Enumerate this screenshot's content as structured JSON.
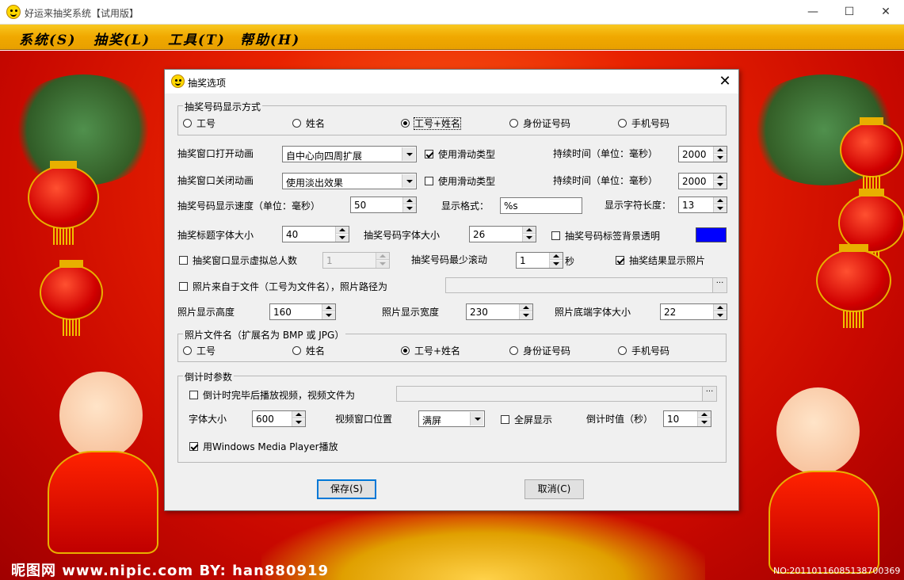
{
  "window": {
    "title": "好运来抽奖系统【试用版】",
    "minimize": "—",
    "maximize": "☐",
    "close": "✕"
  },
  "menu": [
    "系统(S)",
    "抽奖(L)",
    "工具(T)",
    "帮助(H)"
  ],
  "background": {
    "watermark": "昵图网 www.nipic.com  BY: han880919",
    "watermark_no": "NO:20110116085138700369"
  },
  "dialog": {
    "title": "抽奖选项",
    "close": "✕",
    "display_mode_group": {
      "label": "抽奖号码显示方式",
      "options": [
        "工号",
        "姓名",
        "工号+姓名",
        "身份证号码",
        "手机号码"
      ],
      "selected": "工号+姓名"
    },
    "open_anim": {
      "label": "抽奖窗口打开动画",
      "value": "自中心向四周扩展",
      "slide_label": "使用滑动类型",
      "slide_checked": true,
      "duration_label": "持续时间（单位：毫秒）",
      "duration": "2000"
    },
    "close_anim": {
      "label": "抽奖窗口关闭动画",
      "value": "使用淡出效果",
      "slide_label": "使用滑动类型",
      "slide_checked": false,
      "duration_label": "持续时间（单位：毫秒）",
      "duration": "2000"
    },
    "speed": {
      "label": "抽奖号码显示速度（单位：毫秒）",
      "value": "50",
      "format_label": "显示格式：",
      "format_value": "%s",
      "length_label": "显示字符长度：",
      "length_value": "13"
    },
    "fonts": {
      "title_label": "抽奖标题字体大小",
      "title_value": "40",
      "number_label": "抽奖号码字体大小",
      "number_value": "26",
      "transparent_label": "抽奖号码标签背景透明",
      "transparent_checked": false,
      "color": "#0000ff"
    },
    "virtual": {
      "label": "抽奖窗口显示虚拟总人数",
      "checked": false,
      "value": "1",
      "min_roll_label": "抽奖号码最少滚动",
      "min_roll_value": "1",
      "unit": "秒",
      "show_photo_label": "抽奖结果显示照片",
      "show_photo_checked": true
    },
    "photo_path": {
      "label": "照片来自于文件（工号为文件名），照片路径为",
      "checked": false,
      "value": "",
      "browse": "···"
    },
    "photo_size": {
      "height_label": "照片显示高度",
      "height_value": "160",
      "width_label": "照片显示宽度",
      "width_value": "230",
      "font_label": "照片底端字体大小",
      "font_value": "22"
    },
    "photo_name_group": {
      "label": "照片文件名（扩展名为 BMP 或 JPG）",
      "options": [
        "工号",
        "姓名",
        "工号+姓名",
        "身份证号码",
        "手机号码"
      ],
      "selected": "工号+姓名"
    },
    "countdown": {
      "label": "倒计时参数",
      "play_video_label": "倒计时完毕后播放视频，视频文件为",
      "play_video_checked": false,
      "video_path": "",
      "browse": "···",
      "font_label": "字体大小",
      "font_value": "600",
      "pos_label": "视频窗口位置",
      "pos_value": "满屏",
      "fullscreen_label": "全屏显示",
      "fullscreen_checked": false,
      "value_label": "倒计时值（秒）",
      "value": "10",
      "wmp_label": "用Windows Media Player播放",
      "wmp_checked": true
    },
    "save": "保存(S)",
    "cancel": "取消(C)"
  }
}
